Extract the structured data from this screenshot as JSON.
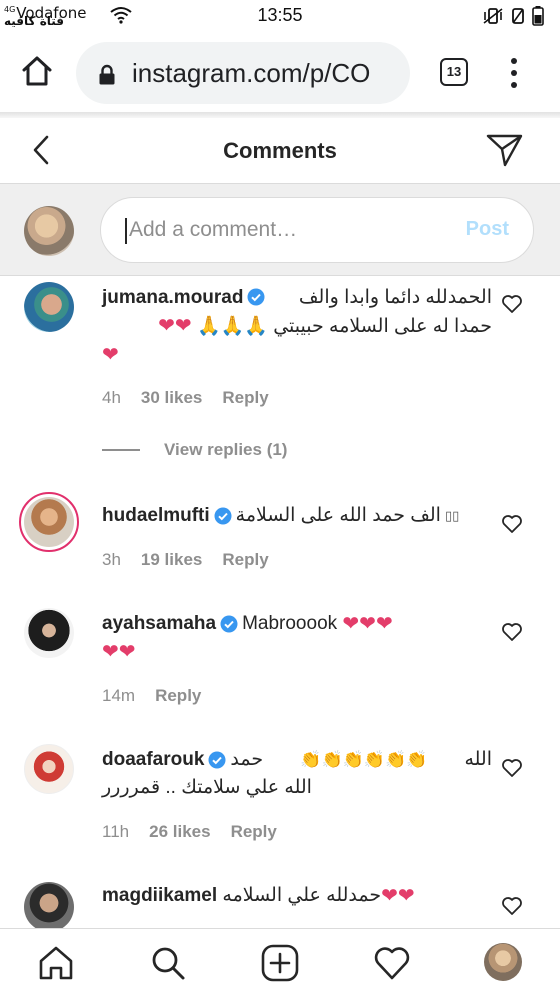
{
  "status_bar": {
    "network": "4G",
    "carrier": "Vodafone",
    "time": "13:55",
    "watermark": "فتاة كافيه"
  },
  "browser": {
    "url": "instagram.com/p/CO",
    "tab_count": "13"
  },
  "header": {
    "title": "Comments"
  },
  "composer": {
    "placeholder": "Add a comment…",
    "post_label": "Post"
  },
  "comments": [
    {
      "username": "jumana.mourad",
      "verified": true,
      "text_line1": "الحمدلله دائما وابدا والف",
      "text_line2": "حمدا له على السلامه حبيبتي 🙏🙏🙏",
      "hearts_line2": "❤❤",
      "hearts_line3": "❤",
      "time": "4h",
      "likes": "30 likes",
      "reply": "Reply",
      "view_replies": "View replies (1)"
    },
    {
      "username": "hudaelmufti",
      "verified": true,
      "text": "الف حمد الله على السلامة",
      "time": "3h",
      "likes": "19 likes",
      "reply": "Reply"
    },
    {
      "username": "ayahsamaha",
      "verified": true,
      "text": "Mabrooook",
      "hearts_line1": "❤❤❤",
      "hearts_line2": "❤❤",
      "time": "14m",
      "reply": "Reply"
    },
    {
      "username": "doaafarouk",
      "verified": true,
      "text_line1_end": "الله",
      "text_line1_claps": "👏👏👏👏👏👏",
      "text_line1_start": "حمد",
      "text_line2": "الله علي سلامتك .. قمرررر",
      "time": "11h",
      "likes": "26 likes",
      "reply": "Reply"
    },
    {
      "username": "magdiikamel",
      "verified": false,
      "text": "حمدلله علي السلامه",
      "hearts": "❤❤"
    }
  ],
  "colors": {
    "verified_blue": "#3897f0",
    "heart_pink": "#e33d6a",
    "muted_text": "#8e8e8e",
    "post_disabled": "#b2dffc"
  },
  "icons": [
    "home-icon",
    "lock-icon",
    "tabs-icon",
    "menu-icon",
    "back-icon",
    "direct-message-icon",
    "heart-outline-icon",
    "search-icon",
    "new-post-icon",
    "activity-icon"
  ]
}
